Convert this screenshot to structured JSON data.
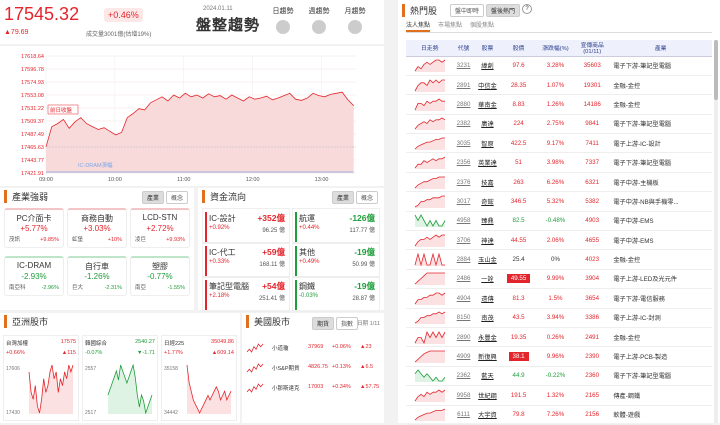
{
  "header": {
    "index_value": "17545.32",
    "change_pct": "+0.46%",
    "change": "▲79.69",
    "volume": "成交量3001億(估增19%)",
    "date": "2024.01.11",
    "trend_label": "盤整趨勢",
    "trend_buttons": [
      {
        "label": "日趨勢"
      },
      {
        "label": "週趨勢"
      },
      {
        "label": "月趨勢"
      }
    ]
  },
  "main_chart": {
    "y_ticks": [
      "17618.64",
      "17596.78",
      "17574.93",
      "17553.08",
      "17531.22",
      "17509.37",
      "17487.49",
      "17465.63",
      "17443.77",
      "17421.91"
    ],
    "x_ticks": [
      "09:00",
      "10:00",
      "11:00",
      "12:00",
      "13:00"
    ],
    "legend_prev": "前日收盤",
    "legend_ic": "IC-DRAM漲幅",
    "colors": {
      "line": "#e3262d",
      "fill": "#f9dada",
      "ic": "#7ea8e6"
    }
  },
  "chart_data": {
    "type": "line",
    "title": "",
    "xlabel": "",
    "ylabel": "",
    "x_range": [
      "09:00",
      "13:30"
    ],
    "ylim": [
      17421.91,
      17618.64
    ],
    "series": [
      {
        "values": [
          17466,
          17500,
          17505,
          17512,
          17497,
          17508,
          17515,
          17505,
          17500,
          17495,
          17498,
          17492,
          17486,
          17490,
          17515,
          17522,
          17530,
          17528,
          17540,
          17545,
          17550,
          17543,
          17553,
          17548,
          17556,
          17550,
          17553,
          17548,
          17555,
          17550,
          17552,
          17546,
          17553,
          17548,
          17543,
          17550,
          17546,
          17548,
          17551,
          17545,
          17548,
          17552,
          17556,
          17546,
          17544,
          17548,
          17556,
          17552,
          17550,
          17554,
          17556,
          17558,
          17545,
          17535
        ]
      }
    ]
  },
  "industry": {
    "title": "產業強弱",
    "tabs": [
      "產業",
      "概念"
    ],
    "items": [
      {
        "name": "PC介面卡",
        "pct": "+5.77%",
        "l": "茂訊",
        "r": "+9.85%",
        "dir": "up"
      },
      {
        "name": "商務自動",
        "pct": "+3.03%",
        "l": "虹堡",
        "r": "+10%",
        "dir": "up"
      },
      {
        "name": "LCD-STN",
        "pct": "+2.72%",
        "l": "凌巨",
        "r": "+9.93%",
        "dir": "up"
      },
      {
        "name": "IC-DRAM",
        "pct": "-2.93%",
        "l": "南亞科",
        "r": "-2.96%",
        "dir": "dn"
      },
      {
        "name": "自行車",
        "pct": "-1.26%",
        "l": "巨大",
        "r": "-2.31%",
        "dir": "dn"
      },
      {
        "name": "塑膠",
        "pct": "-0.77%",
        "l": "南亞",
        "r": "-1.55%",
        "dir": "dn"
      }
    ]
  },
  "money": {
    "title": "資金流向",
    "tabs": [
      "產業",
      "概念"
    ],
    "items": [
      {
        "name": "IC-設計",
        "pct": "+0.92%",
        "v": "+352億",
        "v2": "96.25 億",
        "dir": "up"
      },
      {
        "name": "航運",
        "pct": "+0.44%",
        "v": "-126億",
        "v2": "117.77 億",
        "dir": "dn"
      },
      {
        "name": "IC-代工",
        "pct": "+0.33%",
        "v": "+59億",
        "v2": "168.11 億",
        "dir": "up"
      },
      {
        "name": "其他",
        "pct": "+0.49%",
        "v": "-19億",
        "v2": "50.99 億",
        "dir": "dn"
      },
      {
        "name": "筆記型電腦",
        "pct": "+2.18%",
        "v": "+54億",
        "v2": "251.41 億",
        "dir": "up"
      },
      {
        "name": "鋼鐵",
        "pct": "-0.03%",
        "v": "-19億",
        "v2": "28.87 億",
        "dir": "dn"
      }
    ]
  },
  "asia": {
    "title": "亞洲股市",
    "markets": [
      {
        "name": "台灣加權",
        "price": "17575",
        "pct": "+0.66%",
        "chg": "▲115",
        "y_top": "17606",
        "y_bot": "17430",
        "dir": "up",
        "spark": [
          20,
          26,
          28,
          24,
          30,
          32,
          28,
          22,
          26,
          24,
          20,
          18,
          22,
          20,
          26,
          22,
          24,
          20,
          22,
          18,
          20,
          18
        ]
      },
      {
        "name": "韓國綜合",
        "price": "2540.27",
        "pct": "-0.07%",
        "chg": "▼-1.71",
        "y_top": "2557",
        "y_bot": "2517",
        "dir": "dn",
        "spark": [
          30,
          28,
          26,
          24,
          22,
          25,
          20,
          22,
          24,
          26,
          24,
          22,
          20,
          24,
          30,
          34,
          30,
          32,
          36,
          34,
          32,
          30
        ]
      },
      {
        "name": "日經225",
        "price": "35049.86",
        "pct": "+1.77%",
        "chg": "▲609.14",
        "y_top": "35158",
        "y_bot": "34442",
        "dir": "up",
        "spark": [
          10,
          18,
          22,
          26,
          28,
          30,
          32,
          30,
          28,
          26,
          24,
          26,
          24,
          22,
          20,
          22,
          26,
          24,
          22,
          26,
          24,
          22
        ]
      }
    ]
  },
  "us": {
    "title": "美國股市",
    "tabs": [
      "期貨",
      "指數"
    ],
    "date": "日期 1/11",
    "rows": [
      {
        "name": "小道瓊",
        "v": "37969",
        "pct": "+0.06%",
        "chg": "▲23"
      },
      {
        "name": "小S&P期貨",
        "v": "4826.75",
        "pct": "+0.13%",
        "chg": "▲6.5"
      },
      {
        "name": "小那斯達克",
        "v": "17003",
        "pct": "+0.34%",
        "chg": "▲57.75"
      }
    ]
  },
  "hot": {
    "title": "熱門股",
    "tabs": [
      "盤中即時",
      "盤後熱門"
    ],
    "help": "?",
    "subtabs": [
      "法人焦點",
      "市場焦點",
      "個股焦點"
    ],
    "headers": [
      "日走勢",
      "代號",
      "股票",
      "股價",
      "漲跌幅(%)",
      "宣傳商品",
      "產業"
    ],
    "header_sub": "(01/11)",
    "rows": [
      {
        "code": "3231",
        "name": "緯創",
        "price": "97.6",
        "pct": "3.28%",
        "vol": "35603",
        "ind": "電子下游-筆記型電腦",
        "lu": false,
        "dir": "up",
        "spark": [
          8,
          6,
          7,
          5,
          4,
          5,
          4,
          3,
          3,
          4,
          3
        ]
      },
      {
        "code": "2891",
        "name": "中信金",
        "price": "28.35",
        "pct": "1.07%",
        "vol": "19301",
        "ind": "金融-金控",
        "lu": false,
        "dir": "up",
        "spark": [
          9,
          7,
          6,
          6,
          7,
          5,
          6,
          5,
          6,
          5,
          5
        ]
      },
      {
        "code": "2880",
        "name": "華南金",
        "price": "8.83",
        "pct": "1.26%",
        "vol": "14186",
        "ind": "金融-金控",
        "lu": false,
        "dir": "up",
        "spark": [
          9,
          6,
          6,
          7,
          5,
          6,
          5,
          5,
          4,
          5,
          5
        ]
      },
      {
        "code": "2382",
        "name": "廣達",
        "price": "224",
        "pct": "2.75%",
        "vol": "9841",
        "ind": "電子下游-筆記型電腦",
        "lu": false,
        "dir": "up",
        "spark": [
          9,
          7,
          6,
          5,
          6,
          4,
          5,
          4,
          4,
          3,
          4
        ]
      },
      {
        "code": "3035",
        "name": "智原",
        "price": "422.5",
        "pct": "9.17%",
        "vol": "7411",
        "ind": "電子上游-IC-設計",
        "lu": false,
        "dir": "up",
        "spark": [
          10,
          8,
          7,
          6,
          5,
          5,
          4,
          3,
          3,
          2,
          2
        ]
      },
      {
        "code": "2356",
        "name": "英業達",
        "price": "51",
        "pct": "3.98%",
        "vol": "7337",
        "ind": "電子下游-筆記型電腦",
        "lu": false,
        "dir": "up",
        "spark": [
          9,
          7,
          7,
          5,
          6,
          5,
          4,
          5,
          4,
          4,
          3
        ]
      },
      {
        "code": "2376",
        "name": "技嘉",
        "price": "263",
        "pct": "6.26%",
        "vol": "6321",
        "ind": "電子中游-主機板",
        "lu": false,
        "dir": "up",
        "spark": [
          10,
          8,
          7,
          6,
          6,
          5,
          4,
          4,
          3,
          3,
          3
        ]
      },
      {
        "code": "3017",
        "name": "奇鋐",
        "price": "346.5",
        "pct": "5.32%",
        "vol": "5382",
        "ind": "電子中游-NB與手機零...",
        "lu": false,
        "dir": "up",
        "spark": [
          9,
          8,
          6,
          6,
          5,
          5,
          4,
          4,
          4,
          3,
          3
        ]
      },
      {
        "code": "4958",
        "name": "臻鼎",
        "price": "82.5",
        "pct": "-0.48%",
        "vol": "4903",
        "ind": "電子中游-EMS",
        "lu": false,
        "dir": "dn",
        "spark": [
          5,
          6,
          5,
          6,
          7,
          6,
          7,
          6,
          7,
          7,
          6
        ]
      },
      {
        "code": "3706",
        "name": "神達",
        "price": "44.55",
        "pct": "2.06%",
        "vol": "4655",
        "ind": "電子中游-EMS",
        "lu": false,
        "dir": "up",
        "spark": [
          9,
          7,
          6,
          6,
          5,
          6,
          5,
          4,
          5,
          4,
          4
        ]
      },
      {
        "code": "2884",
        "name": "玉山金",
        "price": "25.4",
        "pct": "0%",
        "vol": "4023",
        "ind": "金融-金控",
        "lu": false,
        "dir": "flat",
        "spark": [
          6,
          5,
          6,
          5,
          6,
          6,
          5,
          6,
          5,
          6,
          6
        ]
      },
      {
        "code": "2486",
        "name": "一詮",
        "price": "49.55",
        "pct": "9.99%",
        "vol": "3904",
        "ind": "電子上游-LED及光元件",
        "lu": true,
        "dir": "up",
        "spark": [
          10,
          8,
          6,
          4,
          2,
          2,
          2,
          2,
          2,
          2,
          2
        ]
      },
      {
        "code": "4904",
        "name": "遠傳",
        "price": "81.3",
        "pct": "1.5%",
        "vol": "3654",
        "ind": "電子下游-電信服務",
        "lu": false,
        "dir": "up",
        "spark": [
          9,
          7,
          7,
          6,
          6,
          5,
          5,
          4,
          4,
          5,
          4
        ]
      },
      {
        "code": "8150",
        "name": "南茂",
        "price": "43.5",
        "pct": "3.94%",
        "vol": "3386",
        "ind": "電子上游-IC-封測",
        "lu": false,
        "dir": "up",
        "spark": [
          9,
          8,
          6,
          6,
          5,
          5,
          4,
          4,
          3,
          4,
          3
        ]
      },
      {
        "code": "2890",
        "name": "永豐金",
        "price": "19.35",
        "pct": "0.26%",
        "vol": "2491",
        "ind": "金融-金控",
        "lu": false,
        "dir": "up",
        "spark": [
          7,
          6,
          6,
          7,
          5,
          6,
          5,
          6,
          5,
          6,
          5
        ]
      },
      {
        "code": "4909",
        "name": "新復興",
        "price": "38.1",
        "pct": "9.96%",
        "vol": "2390",
        "ind": "電子上游-PCB-製造",
        "lu": true,
        "dir": "up",
        "spark": [
          10,
          8,
          6,
          4,
          3,
          2,
          2,
          2,
          2,
          2,
          2
        ]
      },
      {
        "code": "2362",
        "name": "藍天",
        "price": "44.9",
        "pct": "-0.22%",
        "vol": "2360",
        "ind": "電子下游-筆記型電腦",
        "lu": false,
        "dir": "dn",
        "spark": [
          5,
          4,
          5,
          6,
          5,
          6,
          7,
          6,
          7,
          7,
          6
        ]
      },
      {
        "code": "9958",
        "name": "世紀鋼",
        "price": "191.5",
        "pct": "1.32%",
        "vol": "2165",
        "ind": "傳產-鋼鐵",
        "lu": false,
        "dir": "up",
        "spark": [
          9,
          7,
          6,
          7,
          5,
          6,
          5,
          5,
          4,
          5,
          4
        ]
      },
      {
        "code": "6111",
        "name": "大宇資",
        "price": "79.8",
        "pct": "7.26%",
        "vol": "2156",
        "ind": "軟體-遊戲",
        "lu": false,
        "dir": "up",
        "spark": [
          10,
          8,
          7,
          6,
          5,
          5,
          4,
          3,
          3,
          3,
          2
        ]
      }
    ]
  }
}
